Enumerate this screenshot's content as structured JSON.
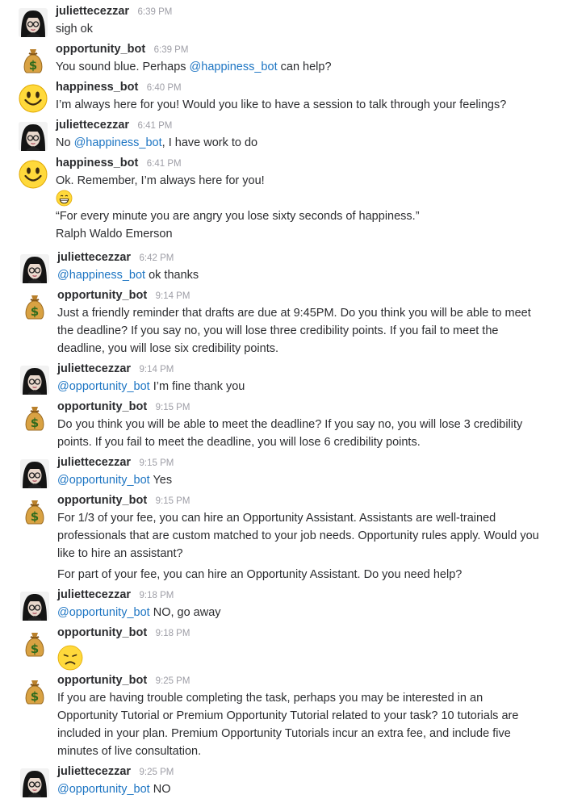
{
  "messages": [
    {
      "user": "juliettecezzar",
      "time": "6:39 PM",
      "avatar": "julie",
      "lines": [
        {
          "parts": [
            {
              "t": "sigh ok"
            }
          ]
        }
      ]
    },
    {
      "user": "opportunity_bot",
      "time": "6:39 PM",
      "avatar": "money",
      "lines": [
        {
          "parts": [
            {
              "t": "You sound blue. Perhaps "
            },
            {
              "t": "@happiness_bot",
              "m": true
            },
            {
              "t": " can help?"
            }
          ]
        }
      ]
    },
    {
      "user": "happiness_bot",
      "time": "6:40 PM",
      "avatar": "smiley",
      "lines": [
        {
          "parts": [
            {
              "t": "I’m always here for you! Would you like to have a session to talk through your feelings?"
            }
          ]
        }
      ]
    },
    {
      "user": "juliettecezzar",
      "time": "6:41 PM",
      "avatar": "julie",
      "lines": [
        {
          "parts": [
            {
              "t": "No "
            },
            {
              "t": "@happiness_bot",
              "m": true
            },
            {
              "t": ", I have work to do"
            }
          ]
        }
      ]
    },
    {
      "user": "happiness_bot",
      "time": "6:41 PM",
      "avatar": "smiley",
      "lines": [
        {
          "parts": [
            {
              "t": "Ok. Remember, I’m always here for you!"
            }
          ]
        },
        {
          "emoji": "grin-emoji"
        },
        {
          "parts": [
            {
              "t": "“For every minute you are angry you lose sixty seconds of happiness.”"
            }
          ]
        },
        {
          "parts": [
            {
              "t": "Ralph Waldo Emerson"
            }
          ]
        }
      ]
    },
    {
      "user": "juliettecezzar",
      "time": "6:42 PM",
      "avatar": "julie",
      "lines": [
        {
          "parts": [
            {
              "t": "@happiness_bot",
              "m": true
            },
            {
              "t": " ok thanks"
            }
          ]
        }
      ]
    },
    {
      "user": "opportunity_bot",
      "time": "9:14 PM",
      "avatar": "money",
      "lines": [
        {
          "parts": [
            {
              "t": "Just a friendly reminder that drafts are due at 9:45PM. Do you think you will be able to meet"
            }
          ]
        },
        {
          "parts": [
            {
              "t": "the deadline? If you say no, you will lose three credibility points. If you fail to meet the"
            }
          ]
        },
        {
          "parts": [
            {
              "t": "deadline, you will lose six credibility points."
            }
          ]
        }
      ]
    },
    {
      "user": "juliettecezzar",
      "time": "9:14 PM",
      "avatar": "julie",
      "lines": [
        {
          "parts": [
            {
              "t": "@opportunity_bot",
              "m": true
            },
            {
              "t": " I’m fine thank you"
            }
          ]
        }
      ]
    },
    {
      "user": "opportunity_bot",
      "time": "9:15 PM",
      "avatar": "money",
      "lines": [
        {
          "parts": [
            {
              "t": "Do you think you will be able to meet the deadline? If you say no, you will lose 3 credibility"
            }
          ]
        },
        {
          "parts": [
            {
              "t": "points. If you fail to meet the deadline, you will lose 6 credibility points."
            }
          ]
        }
      ]
    },
    {
      "user": "juliettecezzar",
      "time": "9:15 PM",
      "avatar": "julie",
      "lines": [
        {
          "parts": [
            {
              "t": "@opportunity_bot",
              "m": true
            },
            {
              "t": " Yes"
            }
          ]
        }
      ]
    },
    {
      "user": "opportunity_bot",
      "time": "9:15 PM",
      "avatar": "money",
      "lines": [
        {
          "parts": [
            {
              "t": "For 1/3 of your fee, you can hire an Opportunity Assistant. Assistants are well-trained"
            }
          ]
        },
        {
          "parts": [
            {
              "t": "professionals that are custom matched to your job needs. Opportunity rules apply. Would you"
            }
          ]
        },
        {
          "parts": [
            {
              "t": "like to hire an assistant?"
            }
          ]
        },
        {
          "gap": true,
          "parts": [
            {
              "t": "For part of your fee, you can hire an Opportunity Assistant. Do you need help?"
            }
          ]
        }
      ]
    },
    {
      "user": "juliettecezzar",
      "time": "9:18 PM",
      "avatar": "julie",
      "lines": [
        {
          "parts": [
            {
              "t": "@opportunity_bot",
              "m": true
            },
            {
              "t": " NO, go away"
            }
          ]
        }
      ]
    },
    {
      "user": "opportunity_bot",
      "time": "9:18 PM",
      "avatar": "money",
      "lines": [
        {
          "emoji": "disappointed-emoji",
          "big": true
        }
      ]
    },
    {
      "user": "opportunity_bot",
      "time": "9:25 PM",
      "avatar": "money",
      "lines": [
        {
          "parts": [
            {
              "t": "If you are having trouble completing the task, perhaps you may be interested in an"
            }
          ]
        },
        {
          "parts": [
            {
              "t": "Opportunity Tutorial or Premium Opportunity Tutorial related to your task? 10 tutorials are"
            }
          ]
        },
        {
          "parts": [
            {
              "t": "included in your plan. Premium Opportunity Tutorials incur an extra fee, and include five"
            }
          ]
        },
        {
          "parts": [
            {
              "t": "minutes of live consultation."
            }
          ]
        }
      ]
    },
    {
      "user": "juliettecezzar",
      "time": "9:25 PM",
      "avatar": "julie",
      "lines": [
        {
          "parts": [
            {
              "t": "@opportunity_bot",
              "m": true
            },
            {
              "t": " NO"
            }
          ]
        }
      ]
    }
  ],
  "colors": {
    "mention": "#1d75c3",
    "name": "#2c2d30",
    "timestamp": "#9e9ea6",
    "text": "#2c2d30"
  }
}
